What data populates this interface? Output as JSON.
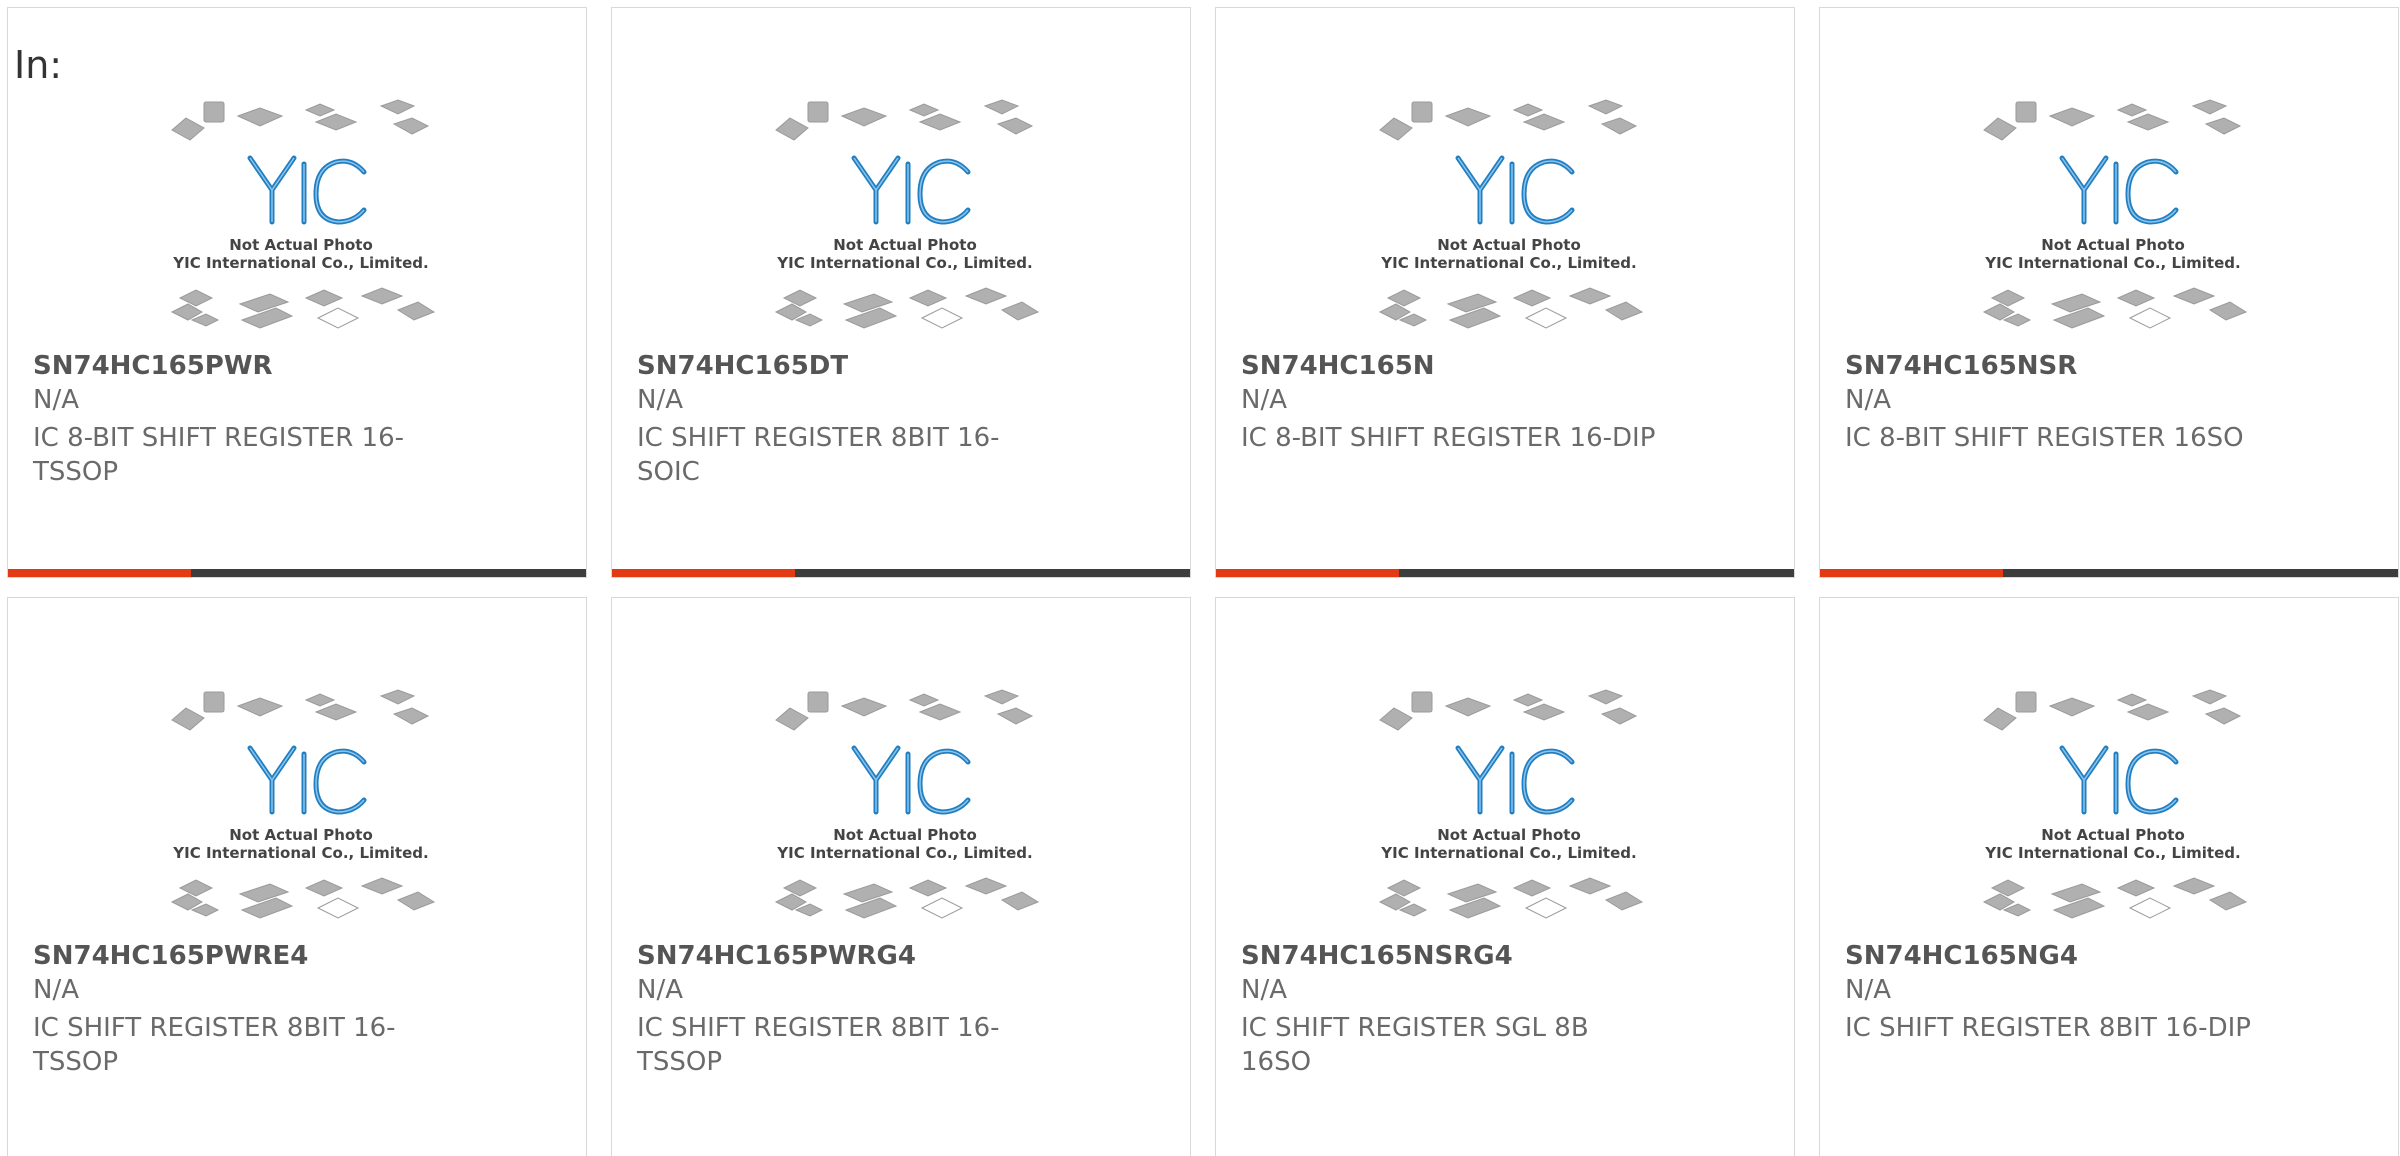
{
  "header": {
    "in_label": "In:"
  },
  "photo": {
    "logo_text": "YIC",
    "caption_line1": "Not Actual Photo",
    "caption_line2": "YIC International Co., Limited."
  },
  "colors": {
    "accent": "#e23a13",
    "bar": "#3d3d3d",
    "logo_blue": "#1f7fc2",
    "chip_gray": "#b0b0b0"
  },
  "products": [
    {
      "part_number": "SN74HC165PWR",
      "manufacturer": "N/A",
      "description": "IC 8-BIT SHIFT REGISTER 16-TSSOP"
    },
    {
      "part_number": "SN74HC165DT",
      "manufacturer": "N/A",
      "description": "IC SHIFT REGISTER 8BIT 16-SOIC"
    },
    {
      "part_number": "SN74HC165N",
      "manufacturer": "N/A",
      "description": "IC 8-BIT SHIFT REGISTER 16-DIP"
    },
    {
      "part_number": "SN74HC165NSR",
      "manufacturer": "N/A",
      "description": "IC 8-BIT SHIFT REGISTER 16SO"
    },
    {
      "part_number": "SN74HC165PWRE4",
      "manufacturer": "N/A",
      "description": "IC SHIFT REGISTER 8BIT 16-TSSOP"
    },
    {
      "part_number": "SN74HC165PWRG4",
      "manufacturer": "N/A",
      "description": "IC SHIFT REGISTER 8BIT 16-TSSOP"
    },
    {
      "part_number": "SN74HC165NSRG4",
      "manufacturer": "N/A",
      "description": "IC SHIFT REGISTER SGL 8B 16SO"
    },
    {
      "part_number": "SN74HC165NG4",
      "manufacturer": "N/A",
      "description": "IC SHIFT REGISTER 8BIT 16-DIP"
    }
  ]
}
